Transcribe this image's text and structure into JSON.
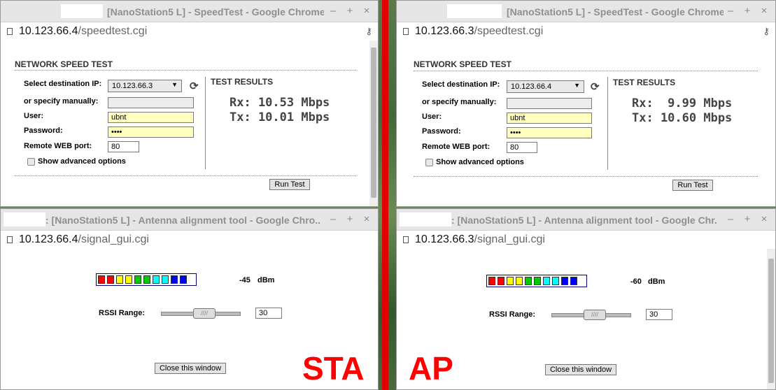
{
  "windows": {
    "sta_speed": {
      "title": "[NanoStation5 L] - SpeedTest - Google Chrome",
      "url_host": "10.123.66.4",
      "url_path": "/speedtest.cgi",
      "heading": "NETWORK SPEED TEST",
      "dest_ip_label": "Select destination IP:",
      "dest_ip_value": "10.123.66.3",
      "manual_label": "or specify manually:",
      "user_label": "User:",
      "user_value": "ubnt",
      "password_label": "Password:",
      "password_value": "••••",
      "port_label": "Remote WEB port:",
      "port_value": "80",
      "advanced_label": "Show advanced options",
      "results_title": "TEST RESULTS",
      "rx": "Rx: 10.53 Mbps",
      "tx": "Tx: 10.01 Mbps",
      "run_button": "Run Test"
    },
    "ap_speed": {
      "title": "[NanoStation5 L] - SpeedTest - Google Chrome",
      "url_host": "10.123.66.3",
      "url_path": "/speedtest.cgi",
      "heading": "NETWORK SPEED TEST",
      "dest_ip_label": "Select destination IP:",
      "dest_ip_value": "10.123.66.4",
      "manual_label": "or specify manually:",
      "user_label": "User:",
      "user_value": "ubnt",
      "password_label": "Password:",
      "password_value": "••••",
      "port_label": "Remote WEB port:",
      "port_value": "80",
      "advanced_label": "Show advanced options",
      "results_title": "TEST RESULTS",
      "rx": "Rx:  9.99 Mbps",
      "tx": "Tx: 10.60 Mbps",
      "run_button": "Run Test"
    },
    "sta_signal": {
      "title": ": [NanoStation5 L] - Antenna alignment tool - Google Chro...",
      "url_host": "10.123.66.4",
      "url_path": "/signal_gui.cgi",
      "signal_value": "-45",
      "signal_unit": "dBm",
      "rssi_label": "RSSI Range:",
      "rssi_value": "30",
      "close_button": "Close this window"
    },
    "ap_signal": {
      "title": ": [NanoStation5 L] - Antenna alignment tool - Google Chr...",
      "url_host": "10.123.66.3",
      "url_path": "/signal_gui.cgi",
      "signal_value": "-60",
      "signal_unit": "dBm",
      "rssi_label": "RSSI Range:",
      "rssi_value": "30",
      "close_button": "Close this window"
    }
  },
  "titlebar_controls": {
    "minimize": "–",
    "maximize": "+",
    "close": "×"
  },
  "labels": {
    "sta": "STA",
    "ap": "AP"
  },
  "meter_colors": [
    "#ff0000",
    "#ff0000",
    "#ffff00",
    "#ffff00",
    "#00cc00",
    "#00cc00",
    "#00ffff",
    "#00ffff",
    "#0000ff",
    "#0000ff"
  ],
  "colors": {
    "divider": "#e00000",
    "label_red": "#ff0000"
  }
}
